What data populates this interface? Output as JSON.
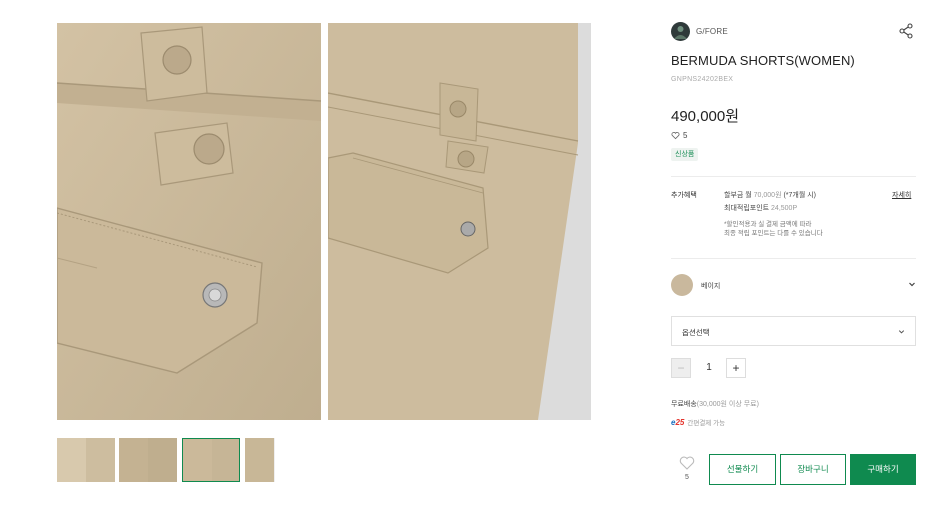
{
  "brand": {
    "name": "G/FORE"
  },
  "product": {
    "title": "BERMUDA SHORTS(WOMEN)",
    "code": "GNPNS24202BEX",
    "price": "490,000원",
    "likes": "5",
    "badge": "신상품"
  },
  "benefits": {
    "label": "추가혜택",
    "installment_prefix": "할부금 월 ",
    "installment_amount": "70,000원",
    "installment_suffix": " (*7개월 시)",
    "points_prefix": "최대적립포인트 ",
    "points_amount": "24,500P",
    "note_line1": "*할인적용과 실 결제 금액에 따라",
    "note_line2": "최종 적립 포인트는 다를 수 있습니다",
    "detail_link": "자세히"
  },
  "color": {
    "selected": "베이지",
    "swatch": "#c9b89d"
  },
  "options": {
    "placeholder": "옵션선택"
  },
  "quantity": {
    "minus": "−",
    "value": "1",
    "plus": "+"
  },
  "shipping": {
    "label": "무료배송",
    "condition": "(30,000원 이상 무료)",
    "pay_logo_a": "e",
    "pay_logo_b": "25",
    "pay_text": "간편결제 가능"
  },
  "actions": {
    "like_count": "5",
    "gift": "선물하기",
    "cart": "장바구니",
    "buy": "구매하기"
  },
  "colors": {
    "accent": "#0f8a4f",
    "fabric": "#c9b89d"
  },
  "icons": [
    "share-icon",
    "heart-icon",
    "chevron-down-icon"
  ]
}
